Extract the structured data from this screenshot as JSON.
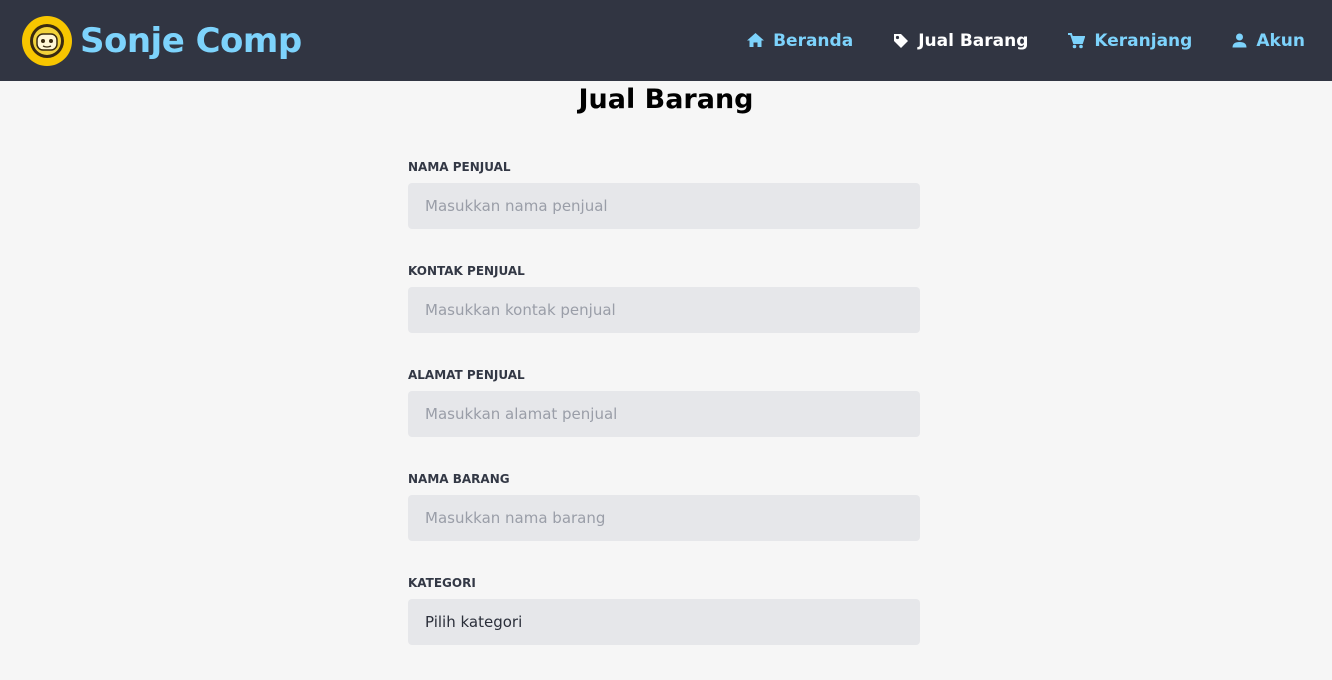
{
  "brand": {
    "name": "Sonje Comp",
    "logo_icon": "robot-mascot-icon",
    "logo_color": "#f7c600",
    "name_color": "#7dd3fc"
  },
  "nav": {
    "background": "#313542",
    "items": [
      {
        "label": "Beranda",
        "icon": "home-icon",
        "active": false
      },
      {
        "label": "Jual Barang",
        "icon": "tag-icon",
        "active": true
      },
      {
        "label": "Keranjang",
        "icon": "cart-icon",
        "active": false
      },
      {
        "label": "Akun",
        "icon": "user-icon",
        "active": false
      }
    ]
  },
  "page": {
    "title": "Jual Barang"
  },
  "form": {
    "fields": [
      {
        "label": "NAMA PENJUAL",
        "placeholder": "Masukkan nama penjual",
        "value": ""
      },
      {
        "label": "KONTAK PENJUAL",
        "placeholder": "Masukkan kontak penjual",
        "value": ""
      },
      {
        "label": "ALAMAT PENJUAL",
        "placeholder": "Masukkan alamat penjual",
        "value": ""
      },
      {
        "label": "NAMA BARANG",
        "placeholder": "Masukkan nama barang",
        "value": ""
      }
    ],
    "category": {
      "label": "KATEGORI",
      "selected": "Pilih kategori"
    }
  }
}
